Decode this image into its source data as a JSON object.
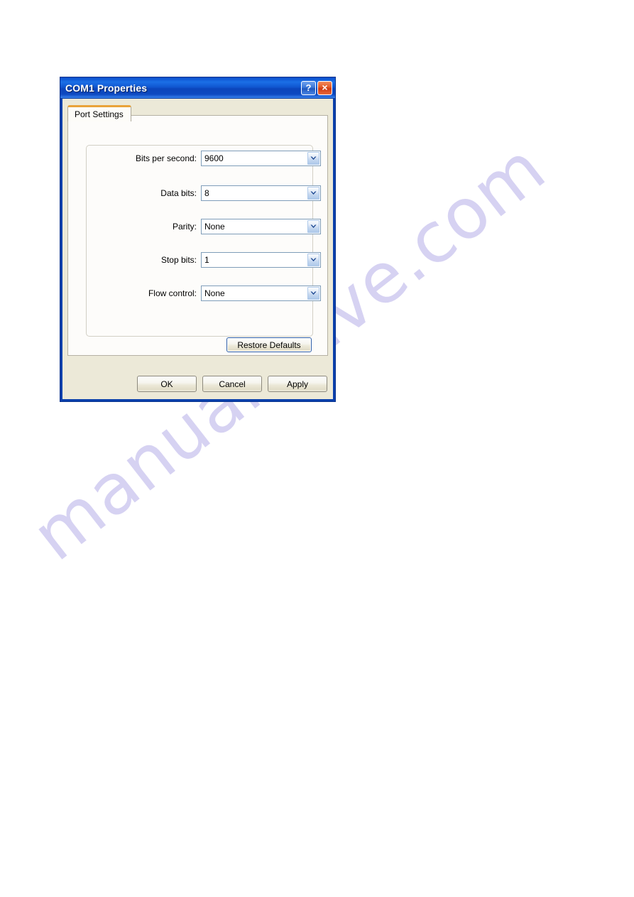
{
  "page": {
    "watermark_text": "manualshive.com",
    "watermark_color": "#d6d2f2",
    "background_color": "#ffffff"
  },
  "dialog": {
    "title": "COM1 Properties",
    "title_bar_color": "#0a4ec6",
    "face_color": "#ece9d8",
    "border_color": "#0a40ac",
    "titlebar_buttons": [
      {
        "name": "help",
        "glyph": "?",
        "color": "#3b77d8"
      },
      {
        "name": "close",
        "glyph": "×",
        "color": "#cf3a12"
      }
    ],
    "tabs": [
      {
        "label": "Port Settings",
        "selected": true,
        "accent_color": "#e9a33a"
      }
    ],
    "fields": [
      {
        "label": "Bits per second:",
        "value": "9600",
        "control": "dropdown"
      },
      {
        "label": "Data bits:",
        "value": "8",
        "control": "dropdown"
      },
      {
        "label": "Parity:",
        "value": "None",
        "control": "dropdown"
      },
      {
        "label": "Stop bits:",
        "value": "1",
        "control": "dropdown"
      },
      {
        "label": "Flow control:",
        "value": "None",
        "control": "dropdown"
      }
    ],
    "restore_button": {
      "label": "Restore Defaults"
    },
    "action_buttons": [
      {
        "label": "OK"
      },
      {
        "label": "Cancel"
      },
      {
        "label": "Apply"
      }
    ]
  }
}
